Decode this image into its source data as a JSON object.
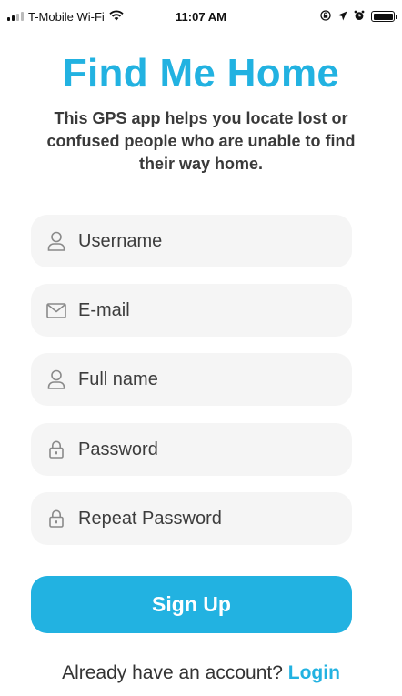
{
  "status_bar": {
    "carrier": "T-Mobile Wi-Fi",
    "time": "11:07 AM",
    "icons": [
      "signal-icon",
      "wifi-icon",
      "screen-lock-icon",
      "location-icon",
      "alarm-icon",
      "battery-icon"
    ]
  },
  "header": {
    "title": "Find Me Home",
    "subtitle": "This GPS  app helps you locate lost or confused people who are unable to find their way home."
  },
  "form": {
    "fields": [
      {
        "placeholder": "Username",
        "icon": "user-icon",
        "value": ""
      },
      {
        "placeholder": "E-mail",
        "icon": "mail-icon",
        "value": ""
      },
      {
        "placeholder": "Full name",
        "icon": "user-icon",
        "value": ""
      },
      {
        "placeholder": "Password",
        "icon": "lock-icon",
        "value": ""
      },
      {
        "placeholder": "Repeat Password",
        "icon": "lock-icon",
        "value": ""
      }
    ],
    "submit_label": "Sign Up"
  },
  "footer": {
    "prompt": "Already have an account?",
    "login_label": "Login"
  },
  "colors": {
    "accent": "#22b2e1",
    "field_bg": "#f5f5f5",
    "text": "#333333"
  }
}
